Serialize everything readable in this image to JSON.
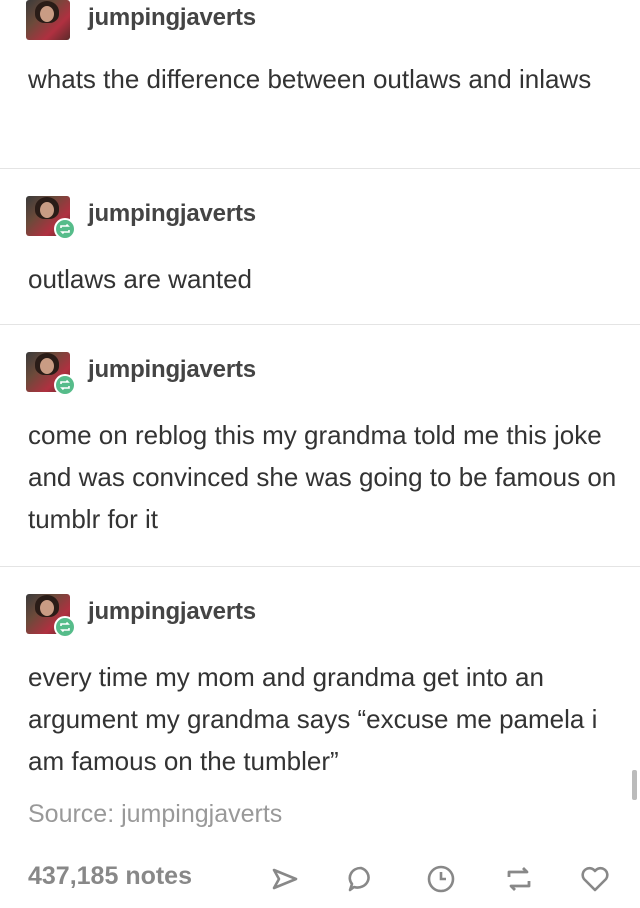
{
  "posts": [
    {
      "username": "jumpingjaverts",
      "text": "whats the difference between outlaws and inlaws",
      "reblog": false
    },
    {
      "username": "jumpingjaverts",
      "text": "outlaws are wanted",
      "reblog": true
    },
    {
      "username": "jumpingjaverts",
      "text": "come on reblog this my grandma told me this joke and was convinced she was going to be famous on tumblr for it",
      "reblog": true
    },
    {
      "username": "jumpingjaverts",
      "text": "every time my mom and grandma get into an argument my grandma says “excuse me pamela i am famous on the tumbler”",
      "reblog": true
    }
  ],
  "source": "Source: jumpingjaverts",
  "footer": {
    "notes": "437,185 notes",
    "actions": [
      "share-icon",
      "reply-icon",
      "queue-icon",
      "reblog-icon",
      "like-icon"
    ]
  },
  "colors": {
    "reblog_badge": "#56bc8a",
    "divider": "#e4e4e4",
    "text": "#333333",
    "muted": "#999999"
  }
}
